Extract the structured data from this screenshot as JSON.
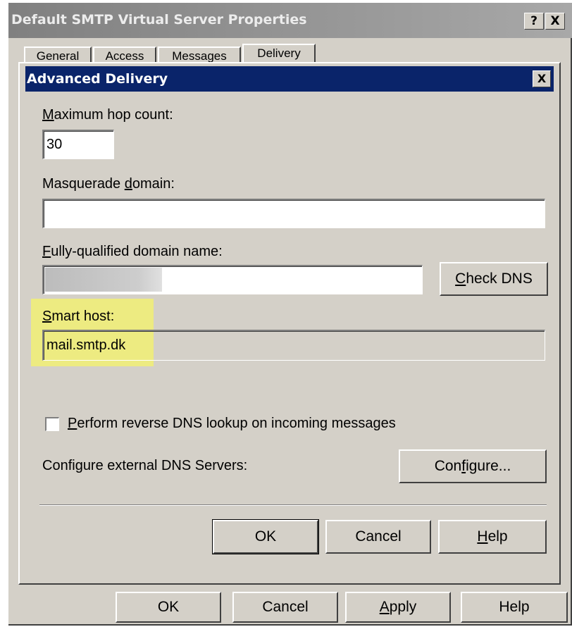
{
  "parent_window": {
    "title": "Default SMTP Virtual Server Properties",
    "help_button": "?",
    "close_button": "X",
    "tabs": [
      "General",
      "Access",
      "Messages",
      "Delivery"
    ],
    "active_tab": "Delivery",
    "buttons": {
      "ok": "OK",
      "cancel": "Cancel",
      "apply": "Apply",
      "help": "Help"
    }
  },
  "dialog": {
    "title": "Advanced Delivery",
    "close_button": "X",
    "max_hop": {
      "label": "Maximum hop count:",
      "value": "30"
    },
    "masquerade": {
      "label": "Masquerade domain:",
      "value": ""
    },
    "fqdn": {
      "label": "Fully-qualified domain name:",
      "value": ""
    },
    "check_dns_label": "Check DNS",
    "smart_host": {
      "label": "Smart host:",
      "value": "mail.smtp.dk"
    },
    "reverse_dns": {
      "label": "Perform reverse DNS lookup on incoming messages",
      "checked": false
    },
    "dns_servers": {
      "label": "Configure external DNS Servers:",
      "button": "Configure..."
    },
    "buttons": {
      "ok": "OK",
      "cancel": "Cancel",
      "help": "Help"
    },
    "highlight_color": "#f6f46a"
  },
  "colors": {
    "face": "#d4d0c8",
    "active_title": "#0a246a",
    "inactive_title": "#808080"
  }
}
